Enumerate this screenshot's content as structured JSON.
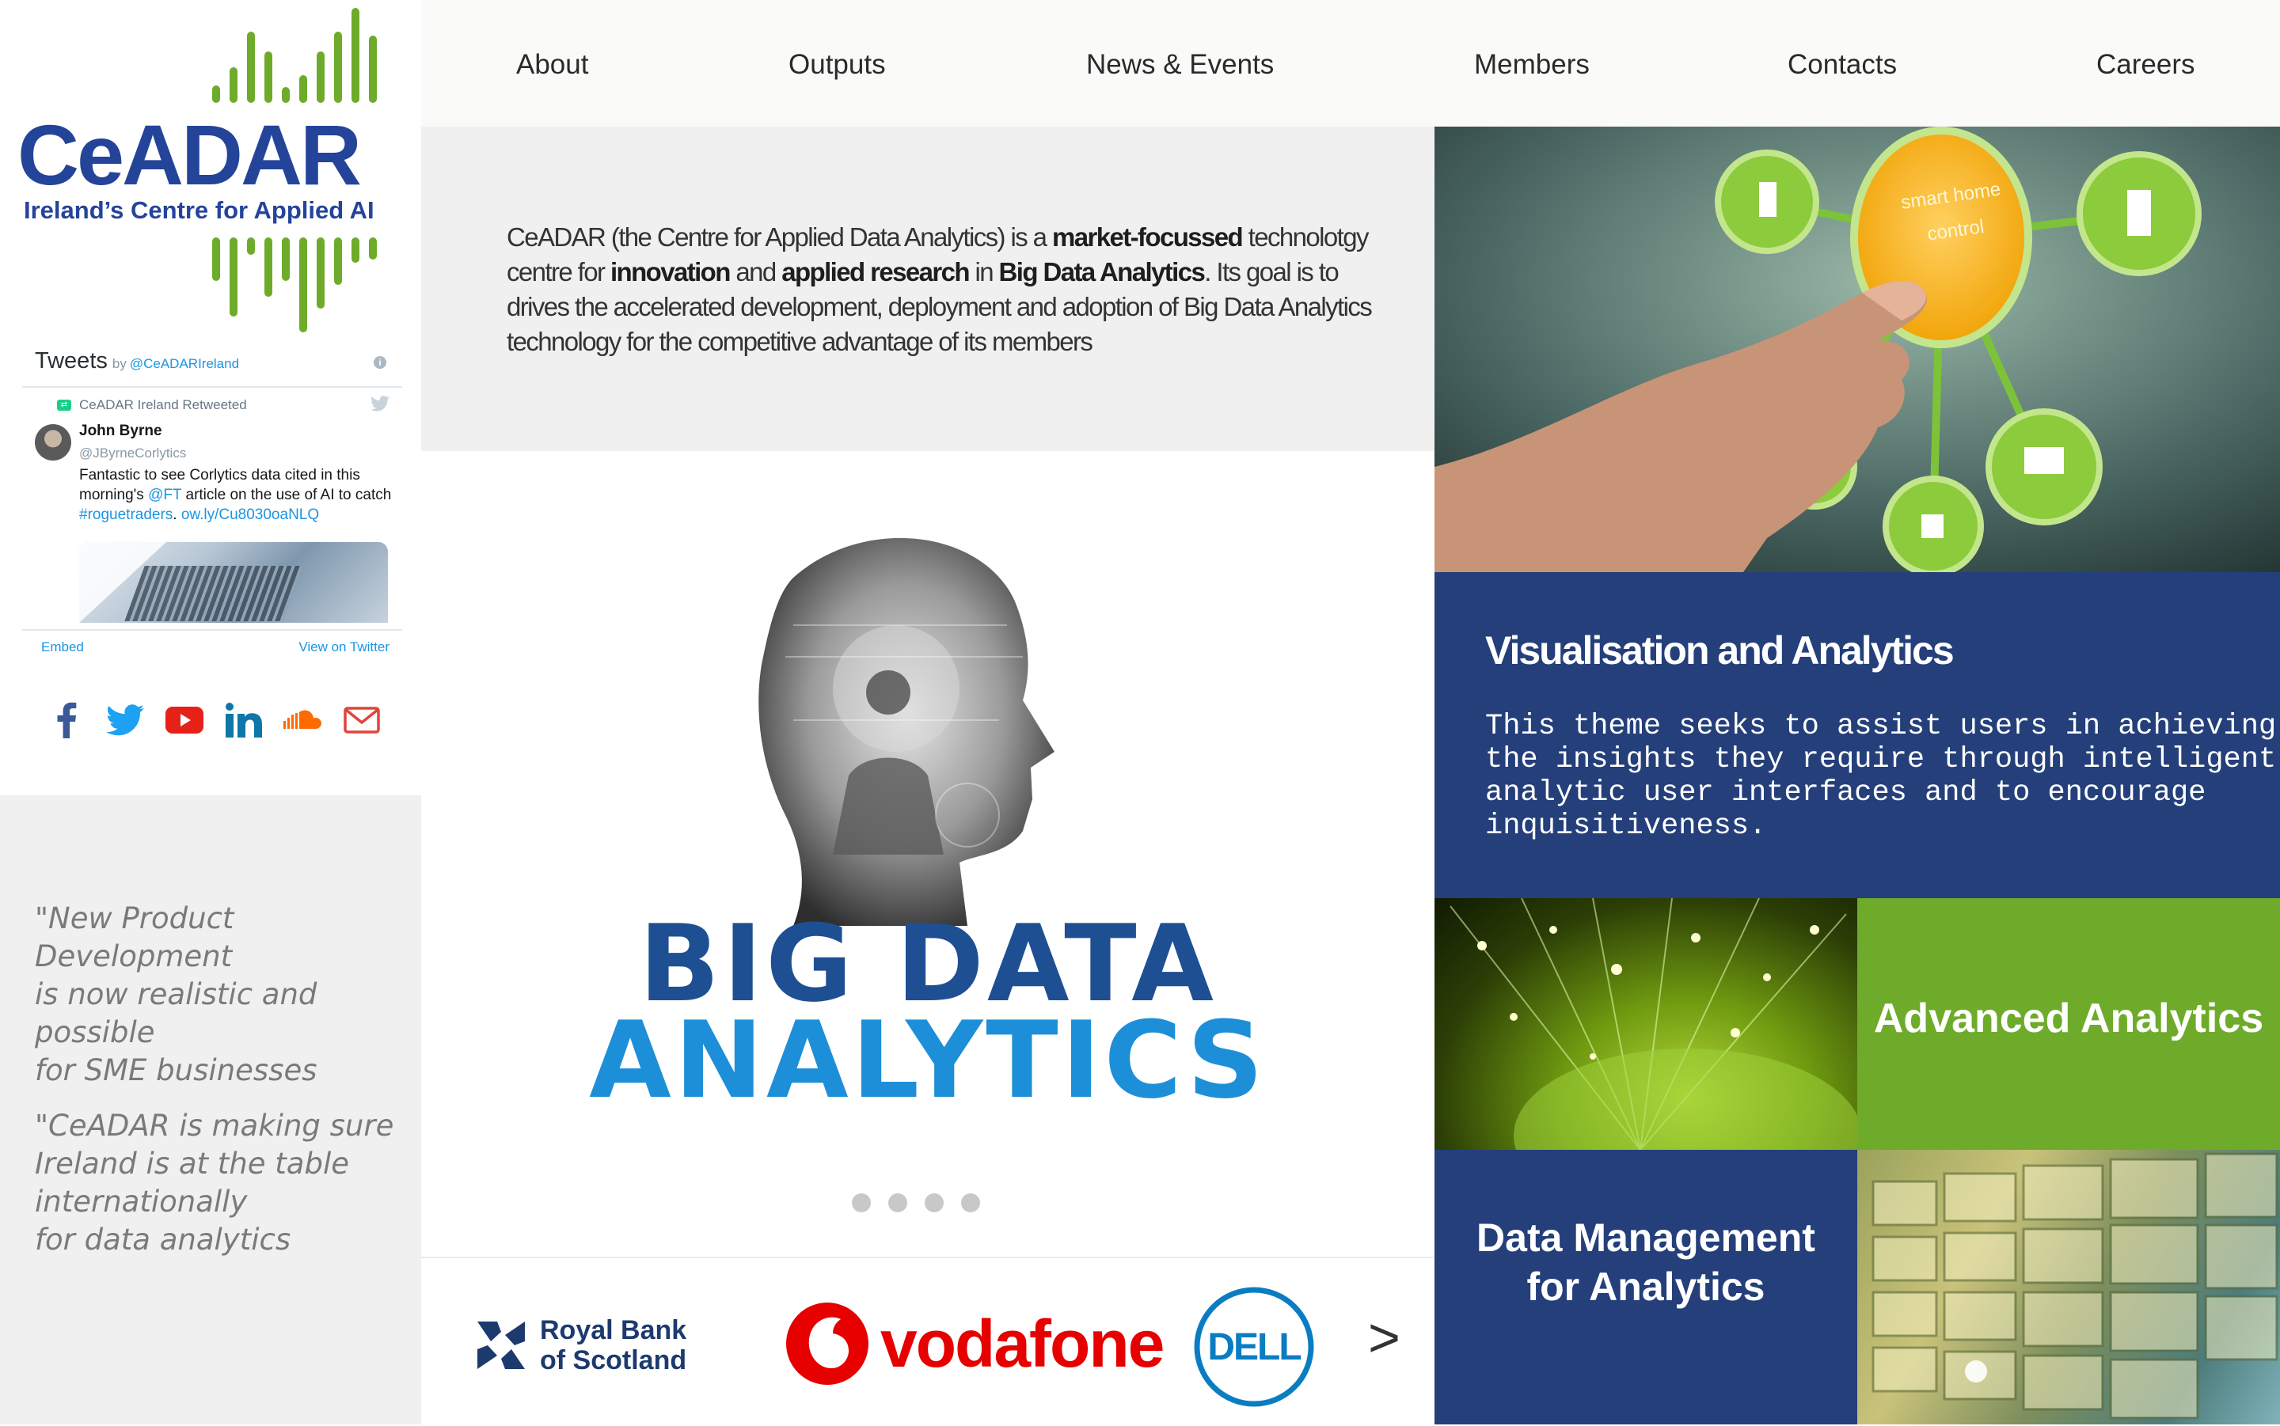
{
  "sidebar": {
    "logo": {
      "name": "CeADAR",
      "tagline": "Ireland’s Centre for Applied AI",
      "brand_blue": "#24449a",
      "brand_green": "#6eab2a"
    },
    "tweets": {
      "title": "Tweets",
      "by": "by",
      "handle": "@CeADARIreland",
      "retweeted_by": "CeADAR Ireland Retweeted",
      "author_name": "John Byrne",
      "author_handle": "@JByrneCorlytics",
      "text_part1": "Fantastic to see Corlytics data cited in this morning's ",
      "mention": "@FT",
      "text_part2": " article on the use of AI to catch ",
      "hashtag": "#roguetraders",
      "text_part3": ". ",
      "link": "ow.ly/Cu8030oaNLQ",
      "embed_label": "Embed",
      "view_label": "View on Twitter"
    },
    "social": [
      {
        "icon": "facebook-icon",
        "color": "#3b5998"
      },
      {
        "icon": "twitter-icon",
        "color": "#1da1f2"
      },
      {
        "icon": "youtube-icon",
        "color": "#e62117"
      },
      {
        "icon": "linkedin-icon",
        "color": "#0e76a8"
      },
      {
        "icon": "soundcloud-icon",
        "color": "#ff6a00"
      },
      {
        "icon": "email-icon",
        "color": "#e0443a"
      }
    ],
    "quotes": [
      "\"New Product Development\nis now realistic and possible\n for SME businesses",
      "\"CeADAR is making sure\nIreland is at the table\ninternationally\nfor data analytics"
    ]
  },
  "nav": {
    "items": [
      "About",
      "Outputs",
      "News & Events",
      "Members",
      "Contacts",
      "Careers"
    ]
  },
  "intro": {
    "p1": "CeADAR (the Centre for Applied Data Analytics) is a ",
    "b1": "market-focussed",
    "p2": " technolotgy centre for ",
    "b2": "innovation",
    "p3": " and ",
    "b3": "applied research",
    "p4": " in ",
    "b4": "Big Data Analytics",
    "p5": ".  Its goal is to drives  the accelerated development, deployment and adoption of Big Data Analytics technology for the competitive advantage of its members"
  },
  "slider": {
    "line1": "BIG DATA",
    "line2": "ANALYTICS",
    "line1_color": "#1f4f93",
    "line2_color": "#1d8fd8",
    "dots": 4
  },
  "partners": {
    "rbs_line1": "Royal Bank",
    "rbs_line2": "of Scotland",
    "vodafone": "vodafone",
    "dell": "DELL",
    "next": ">"
  },
  "tiles": {
    "touch": {
      "line1": "smart home",
      "line2": "control"
    },
    "viz": {
      "title": "Visualisation and Analytics",
      "description": "This theme seeks to assist users in achieving the insights they require through intelligent analytic user interfaces and to encourage inquisitiveness."
    },
    "adv": {
      "title": "Advanced Analytics"
    },
    "dm": {
      "line1": "Data Management",
      "line2": "for Analytics"
    }
  }
}
